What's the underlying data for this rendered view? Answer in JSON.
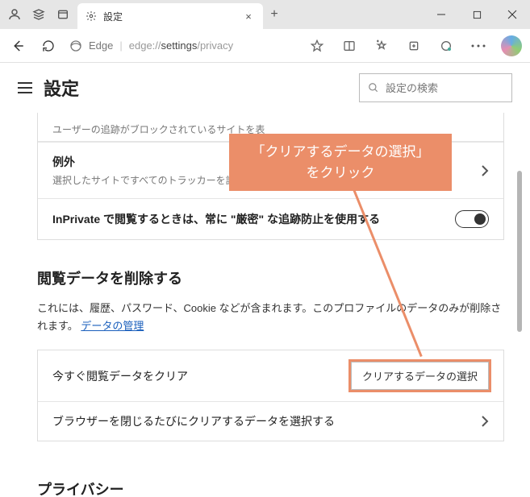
{
  "titlebar": {
    "tab_title": "設定",
    "close": "×",
    "newtab": "+",
    "min": "—",
    "max": "☐"
  },
  "toolbar": {
    "edge_label": "Edge",
    "url_scheme": "edge://",
    "url_path_dark": "settings",
    "url_path_light": "/privacy"
  },
  "settings": {
    "title": "設定",
    "search_placeholder": "設定の検索"
  },
  "tracking": {
    "blocked_note": "ユーザーの追跡がブロックされているサイトを表",
    "exceptions_title": "例外",
    "exceptions_sub": "選択したサイトですべてのトラッカーを許可する",
    "inprivate_label": "InPrivate で閲覧するときは、常に \"厳密\" な追跡防止を使用する"
  },
  "clear": {
    "section_title": "閲覧データを削除する",
    "section_desc_1": "これには、履歴、パスワード、Cookie などが含まれます。このプロファイルのデータのみが削除されます。",
    "section_link": "データの管理",
    "now_title": "今すぐ閲覧データをクリア",
    "choose_btn": "クリアするデータの選択",
    "on_close_title": "ブラウザーを閉じるたびにクリアするデータを選択する"
  },
  "privacy": {
    "section_title": "プライバシー"
  },
  "callout": {
    "line1": "「クリアするデータの選択」",
    "line2": "をクリック"
  }
}
